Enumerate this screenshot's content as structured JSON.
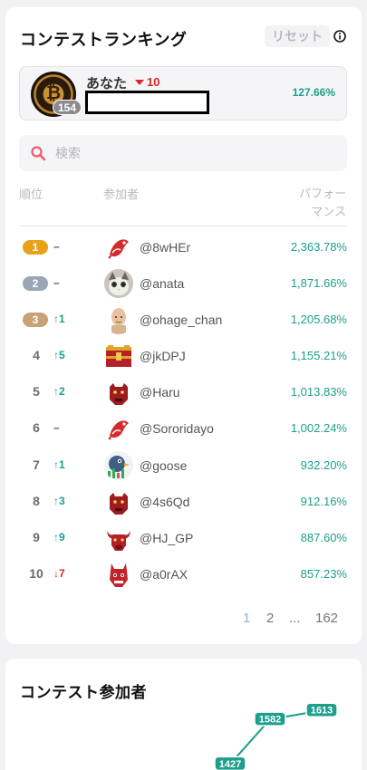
{
  "ranking": {
    "title": "コンテストランキング",
    "reset_label": "リセット",
    "me": {
      "name": "あなた",
      "change": "10",
      "rank": "154",
      "performance": "127.66%"
    },
    "search_placeholder": "検索",
    "headers": {
      "rank": "順位",
      "participant": "参加者",
      "performance_line1": "パフォー",
      "performance_line2": "マンス"
    },
    "rows": [
      {
        "rank": "1",
        "change": "–",
        "dir": "same",
        "user": "@8wHEr",
        "perf": "2,363.78%"
      },
      {
        "rank": "2",
        "change": "–",
        "dir": "same",
        "user": "@anata",
        "perf": "1,871.66%"
      },
      {
        "rank": "3",
        "change": "↑1",
        "dir": "up",
        "user": "@ohage_chan",
        "perf": "1,205.68%"
      },
      {
        "rank": "4",
        "change": "↑5",
        "dir": "up",
        "user": "@jkDPJ",
        "perf": "1,155.21%"
      },
      {
        "rank": "5",
        "change": "↑2",
        "dir": "up",
        "user": "@Haru",
        "perf": "1,013.83%"
      },
      {
        "rank": "6",
        "change": "–",
        "dir": "same",
        "user": "@Sororidayo",
        "perf": "1,002.24%"
      },
      {
        "rank": "7",
        "change": "↑1",
        "dir": "up",
        "user": "@goose",
        "perf": "932.20%"
      },
      {
        "rank": "8",
        "change": "↑3",
        "dir": "up",
        "user": "@4s6Qd",
        "perf": "912.16%"
      },
      {
        "rank": "9",
        "change": "↑9",
        "dir": "up",
        "user": "@HJ_GP",
        "perf": "887.60%"
      },
      {
        "rank": "10",
        "change": "↓7",
        "dir": "down",
        "user": "@a0rAX",
        "perf": "857.23%"
      }
    ],
    "pagination": {
      "page1": "1",
      "page2": "2",
      "ellipsis": "...",
      "last": "162"
    },
    "colors": {
      "accent": "#1d9f8b",
      "down": "#e02424",
      "gold": "#e8a21a",
      "silver": "#9aa6b4",
      "bronze": "#c8a276"
    }
  },
  "participants": {
    "title": "コンテスト参加者",
    "chart_data": {
      "type": "line",
      "values": [
        1427,
        1582,
        1613
      ],
      "labels": [
        "1427",
        "1582",
        "1613"
      ],
      "color": "#1d9f8b"
    }
  }
}
